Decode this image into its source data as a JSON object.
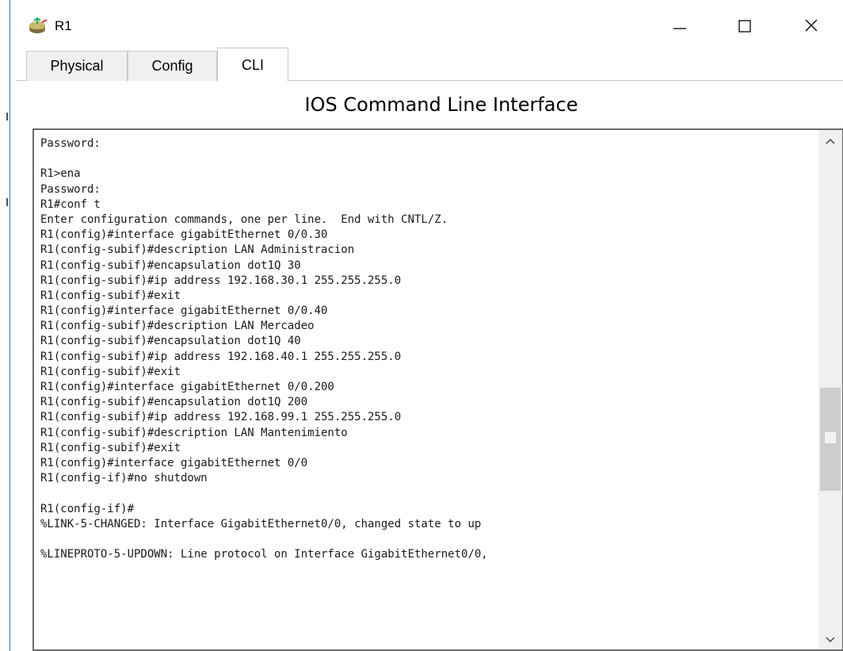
{
  "window": {
    "title": "R1",
    "icon": "router-icon",
    "controls": {
      "minimize": "minimize-icon",
      "maximize": "maximize-icon",
      "close": "close-icon"
    }
  },
  "tabs": [
    {
      "label": "Physical",
      "active": false
    },
    {
      "label": "Config",
      "active": false
    },
    {
      "label": "CLI",
      "active": true
    }
  ],
  "panel": {
    "header": "IOS Command Line Interface"
  },
  "terminal": {
    "lines": [
      "Password:",
      "",
      "R1>ena",
      "Password:",
      "R1#conf t",
      "Enter configuration commands, one per line.  End with CNTL/Z.",
      "R1(config)#interface gigabitEthernet 0/0.30",
      "R1(config-subif)#description LAN Administracion",
      "R1(config-subif)#encapsulation dot1Q 30",
      "R1(config-subif)#ip address 192.168.30.1 255.255.255.0",
      "R1(config-subif)#exit",
      "R1(config)#interface gigabitEthernet 0/0.40",
      "R1(config-subif)#description LAN Mercadeo",
      "R1(config-subif)#encapsulation dot1Q 40",
      "R1(config-subif)#ip address 192.168.40.1 255.255.255.0",
      "R1(config-subif)#exit",
      "R1(config)#interface gigabitEthernet 0/0.200",
      "R1(config-subif)#encapsulation dot1Q 200",
      "R1(config-subif)#ip address 192.168.99.1 255.255.255.0",
      "R1(config-subif)#description LAN Mantenimiento",
      "R1(config-subif)#exit",
      "R1(config)#interface gigabitEthernet 0/0",
      "R1(config-if)#no shutdown",
      "",
      "R1(config-if)#",
      "%LINK-5-CHANGED: Interface GigabitEthernet0/0, changed state to up",
      "",
      "%LINEPROTO-5-UPDOWN: Line protocol on Interface GigabitEthernet0/0,"
    ],
    "scroll_position": 0.63
  },
  "colors": {
    "window_border": "#1e7fd6",
    "terminal_border": "#6b6b6b",
    "scroll_thumb": "#cdcdcd"
  }
}
